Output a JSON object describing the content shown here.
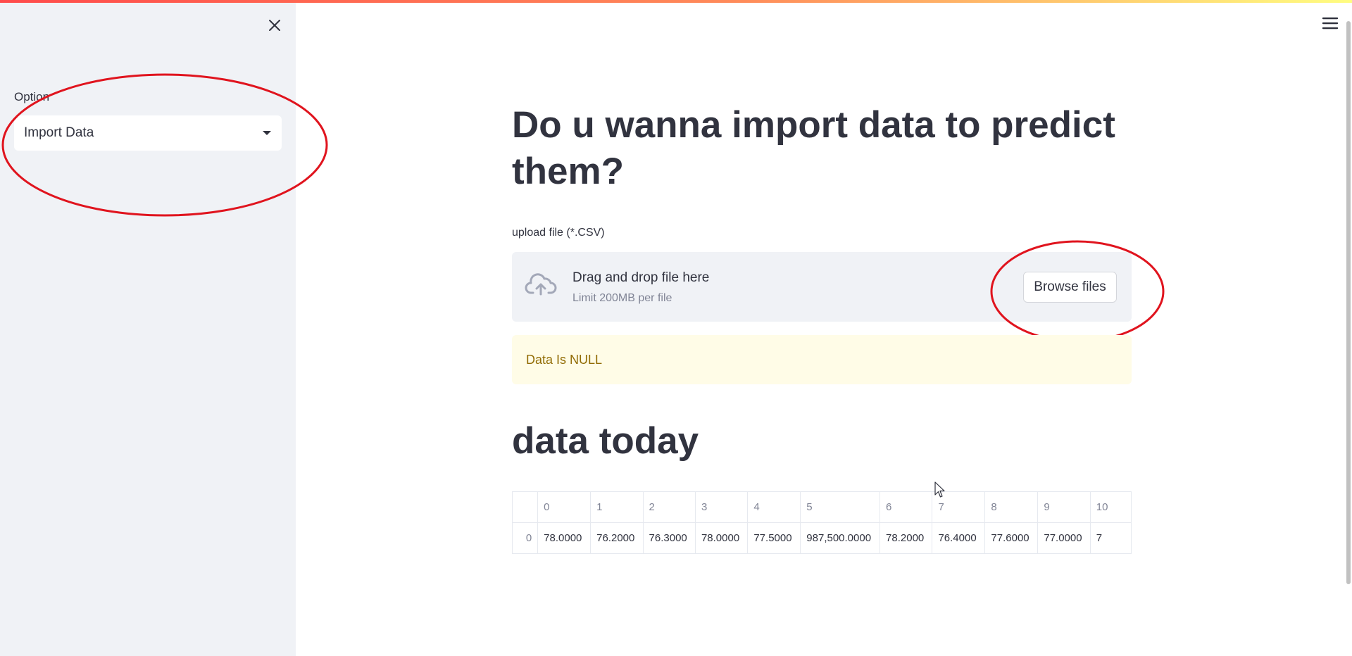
{
  "sidebar": {
    "option_label": "Option",
    "select_value": "Import Data",
    "close_icon": "close-icon",
    "chevron_icon": "caret-down-icon"
  },
  "header": {
    "menu_icon": "hamburger-menu-icon"
  },
  "main": {
    "title": "Do u wanna import data to predict them?",
    "upload": {
      "label": "upload file (*.CSV)",
      "drop_title": "Drag and drop file here",
      "drop_sub": "Limit 200MB per file",
      "browse_label": "Browse files",
      "icon": "cloud-upload-icon"
    },
    "warning": "Data Is NULL",
    "section_title": "data today",
    "table": {
      "columns": [
        "0",
        "1",
        "2",
        "3",
        "4",
        "5",
        "6",
        "7",
        "8",
        "9",
        "10"
      ],
      "rows": [
        {
          "index": "0",
          "cells": [
            "78.0000",
            "76.2000",
            "76.3000",
            "78.0000",
            "77.5000",
            "987,500.0000",
            "78.2000",
            "76.4000",
            "77.6000",
            "77.0000",
            "7"
          ]
        }
      ]
    }
  },
  "colors": {
    "sidebar_bg": "#f0f2f6",
    "text": "#31333f",
    "muted": "#808495",
    "warning_bg": "#fffce7",
    "warning_text": "#926c05",
    "annotation": "#e0141e"
  }
}
